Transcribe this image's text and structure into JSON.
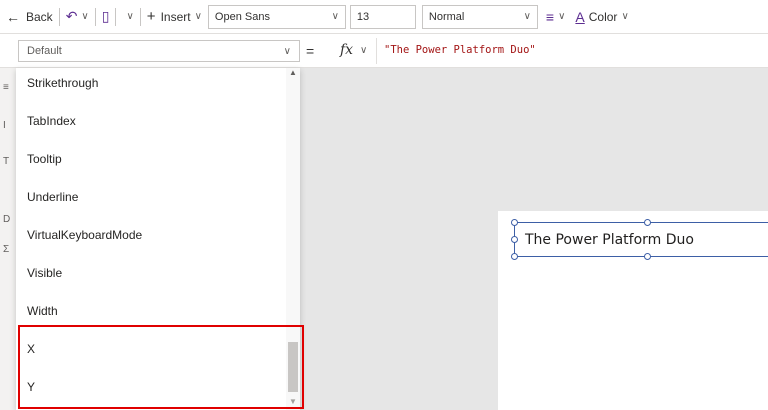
{
  "toolbar": {
    "back_label": "Back",
    "insert_label": "Insert",
    "font_family_value": "Open Sans",
    "font_size_value": "13",
    "font_weight_value": "Normal",
    "color_label": "Color"
  },
  "formula_bar": {
    "property_value": "Default",
    "equals": "=",
    "fx_label": "fx",
    "formula": "\"The Power Platform Duo\""
  },
  "property_list": {
    "items": [
      {
        "label": "Strikethrough"
      },
      {
        "label": "TabIndex"
      },
      {
        "label": "Tooltip"
      },
      {
        "label": "Underline"
      },
      {
        "label": "VirtualKeyboardMode"
      },
      {
        "label": "Visible"
      },
      {
        "label": "Width"
      },
      {
        "label": "X"
      },
      {
        "label": "Y"
      }
    ],
    "highlighted": [
      "X",
      "Y"
    ],
    "highlight_color": "#e00000"
  },
  "canvas": {
    "label_text": "The Power Platform Duo",
    "selection_color": "#3d5fa6"
  }
}
